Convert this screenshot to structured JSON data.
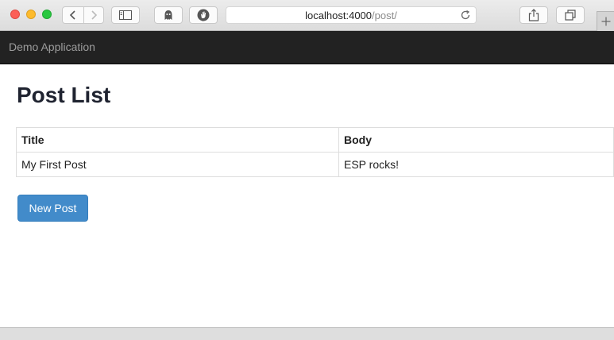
{
  "browser": {
    "url_host": "localhost:4000",
    "url_path": "/post/",
    "icons": [
      "back-icon",
      "forward-icon",
      "sidebar-icon",
      "ghostery-icon",
      "privacy-hand-icon",
      "reload-icon",
      "share-icon",
      "tabs-icon",
      "plus-icon"
    ]
  },
  "navbar": {
    "brand": "Demo Application"
  },
  "main": {
    "title": "Post List",
    "table": {
      "columns": [
        "Title",
        "Body"
      ],
      "rows": [
        [
          "My First Post",
          "ESP rocks!"
        ]
      ]
    },
    "new_post_label": "New Post"
  },
  "colors": {
    "navbar_bg": "#222222",
    "brand_text": "#9d9d9d",
    "primary_button": "#428bca"
  }
}
